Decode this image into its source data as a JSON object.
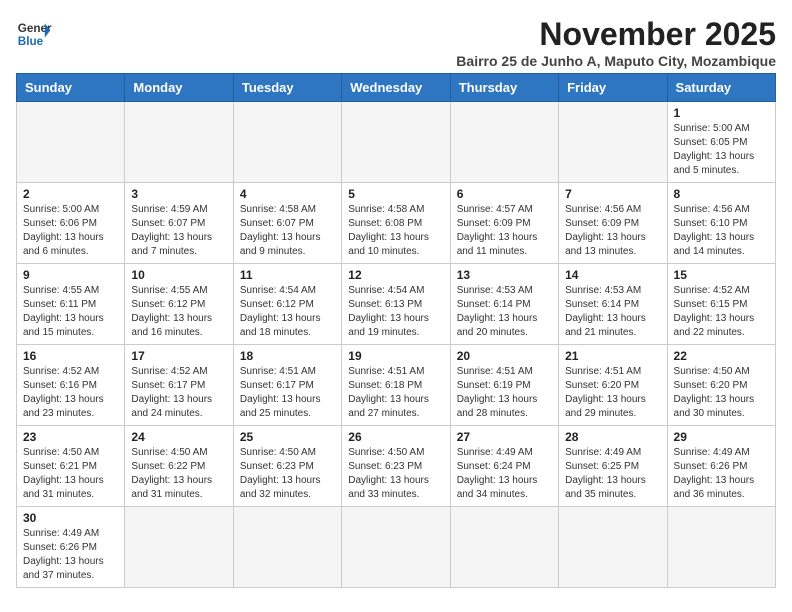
{
  "header": {
    "logo_general": "General",
    "logo_blue": "Blue",
    "month_title": "November 2025",
    "subtitle": "Bairro 25 de Junho A, Maputo City, Mozambique"
  },
  "days_of_week": [
    "Sunday",
    "Monday",
    "Tuesday",
    "Wednesday",
    "Thursday",
    "Friday",
    "Saturday"
  ],
  "weeks": [
    [
      {
        "day": "",
        "info": ""
      },
      {
        "day": "",
        "info": ""
      },
      {
        "day": "",
        "info": ""
      },
      {
        "day": "",
        "info": ""
      },
      {
        "day": "",
        "info": ""
      },
      {
        "day": "",
        "info": ""
      },
      {
        "day": "1",
        "info": "Sunrise: 5:00 AM\nSunset: 6:05 PM\nDaylight: 13 hours and 5 minutes."
      }
    ],
    [
      {
        "day": "2",
        "info": "Sunrise: 5:00 AM\nSunset: 6:06 PM\nDaylight: 13 hours and 6 minutes."
      },
      {
        "day": "3",
        "info": "Sunrise: 4:59 AM\nSunset: 6:07 PM\nDaylight: 13 hours and 7 minutes."
      },
      {
        "day": "4",
        "info": "Sunrise: 4:58 AM\nSunset: 6:07 PM\nDaylight: 13 hours and 9 minutes."
      },
      {
        "day": "5",
        "info": "Sunrise: 4:58 AM\nSunset: 6:08 PM\nDaylight: 13 hours and 10 minutes."
      },
      {
        "day": "6",
        "info": "Sunrise: 4:57 AM\nSunset: 6:09 PM\nDaylight: 13 hours and 11 minutes."
      },
      {
        "day": "7",
        "info": "Sunrise: 4:56 AM\nSunset: 6:09 PM\nDaylight: 13 hours and 13 minutes."
      },
      {
        "day": "8",
        "info": "Sunrise: 4:56 AM\nSunset: 6:10 PM\nDaylight: 13 hours and 14 minutes."
      }
    ],
    [
      {
        "day": "9",
        "info": "Sunrise: 4:55 AM\nSunset: 6:11 PM\nDaylight: 13 hours and 15 minutes."
      },
      {
        "day": "10",
        "info": "Sunrise: 4:55 AM\nSunset: 6:12 PM\nDaylight: 13 hours and 16 minutes."
      },
      {
        "day": "11",
        "info": "Sunrise: 4:54 AM\nSunset: 6:12 PM\nDaylight: 13 hours and 18 minutes."
      },
      {
        "day": "12",
        "info": "Sunrise: 4:54 AM\nSunset: 6:13 PM\nDaylight: 13 hours and 19 minutes."
      },
      {
        "day": "13",
        "info": "Sunrise: 4:53 AM\nSunset: 6:14 PM\nDaylight: 13 hours and 20 minutes."
      },
      {
        "day": "14",
        "info": "Sunrise: 4:53 AM\nSunset: 6:14 PM\nDaylight: 13 hours and 21 minutes."
      },
      {
        "day": "15",
        "info": "Sunrise: 4:52 AM\nSunset: 6:15 PM\nDaylight: 13 hours and 22 minutes."
      }
    ],
    [
      {
        "day": "16",
        "info": "Sunrise: 4:52 AM\nSunset: 6:16 PM\nDaylight: 13 hours and 23 minutes."
      },
      {
        "day": "17",
        "info": "Sunrise: 4:52 AM\nSunset: 6:17 PM\nDaylight: 13 hours and 24 minutes."
      },
      {
        "day": "18",
        "info": "Sunrise: 4:51 AM\nSunset: 6:17 PM\nDaylight: 13 hours and 25 minutes."
      },
      {
        "day": "19",
        "info": "Sunrise: 4:51 AM\nSunset: 6:18 PM\nDaylight: 13 hours and 27 minutes."
      },
      {
        "day": "20",
        "info": "Sunrise: 4:51 AM\nSunset: 6:19 PM\nDaylight: 13 hours and 28 minutes."
      },
      {
        "day": "21",
        "info": "Sunrise: 4:51 AM\nSunset: 6:20 PM\nDaylight: 13 hours and 29 minutes."
      },
      {
        "day": "22",
        "info": "Sunrise: 4:50 AM\nSunset: 6:20 PM\nDaylight: 13 hours and 30 minutes."
      }
    ],
    [
      {
        "day": "23",
        "info": "Sunrise: 4:50 AM\nSunset: 6:21 PM\nDaylight: 13 hours and 31 minutes."
      },
      {
        "day": "24",
        "info": "Sunrise: 4:50 AM\nSunset: 6:22 PM\nDaylight: 13 hours and 31 minutes."
      },
      {
        "day": "25",
        "info": "Sunrise: 4:50 AM\nSunset: 6:23 PM\nDaylight: 13 hours and 32 minutes."
      },
      {
        "day": "26",
        "info": "Sunrise: 4:50 AM\nSunset: 6:23 PM\nDaylight: 13 hours and 33 minutes."
      },
      {
        "day": "27",
        "info": "Sunrise: 4:49 AM\nSunset: 6:24 PM\nDaylight: 13 hours and 34 minutes."
      },
      {
        "day": "28",
        "info": "Sunrise: 4:49 AM\nSunset: 6:25 PM\nDaylight: 13 hours and 35 minutes."
      },
      {
        "day": "29",
        "info": "Sunrise: 4:49 AM\nSunset: 6:26 PM\nDaylight: 13 hours and 36 minutes."
      }
    ],
    [
      {
        "day": "30",
        "info": "Sunrise: 4:49 AM\nSunset: 6:26 PM\nDaylight: 13 hours and 37 minutes."
      },
      {
        "day": "",
        "info": ""
      },
      {
        "day": "",
        "info": ""
      },
      {
        "day": "",
        "info": ""
      },
      {
        "day": "",
        "info": ""
      },
      {
        "day": "",
        "info": ""
      },
      {
        "day": "",
        "info": ""
      }
    ]
  ]
}
